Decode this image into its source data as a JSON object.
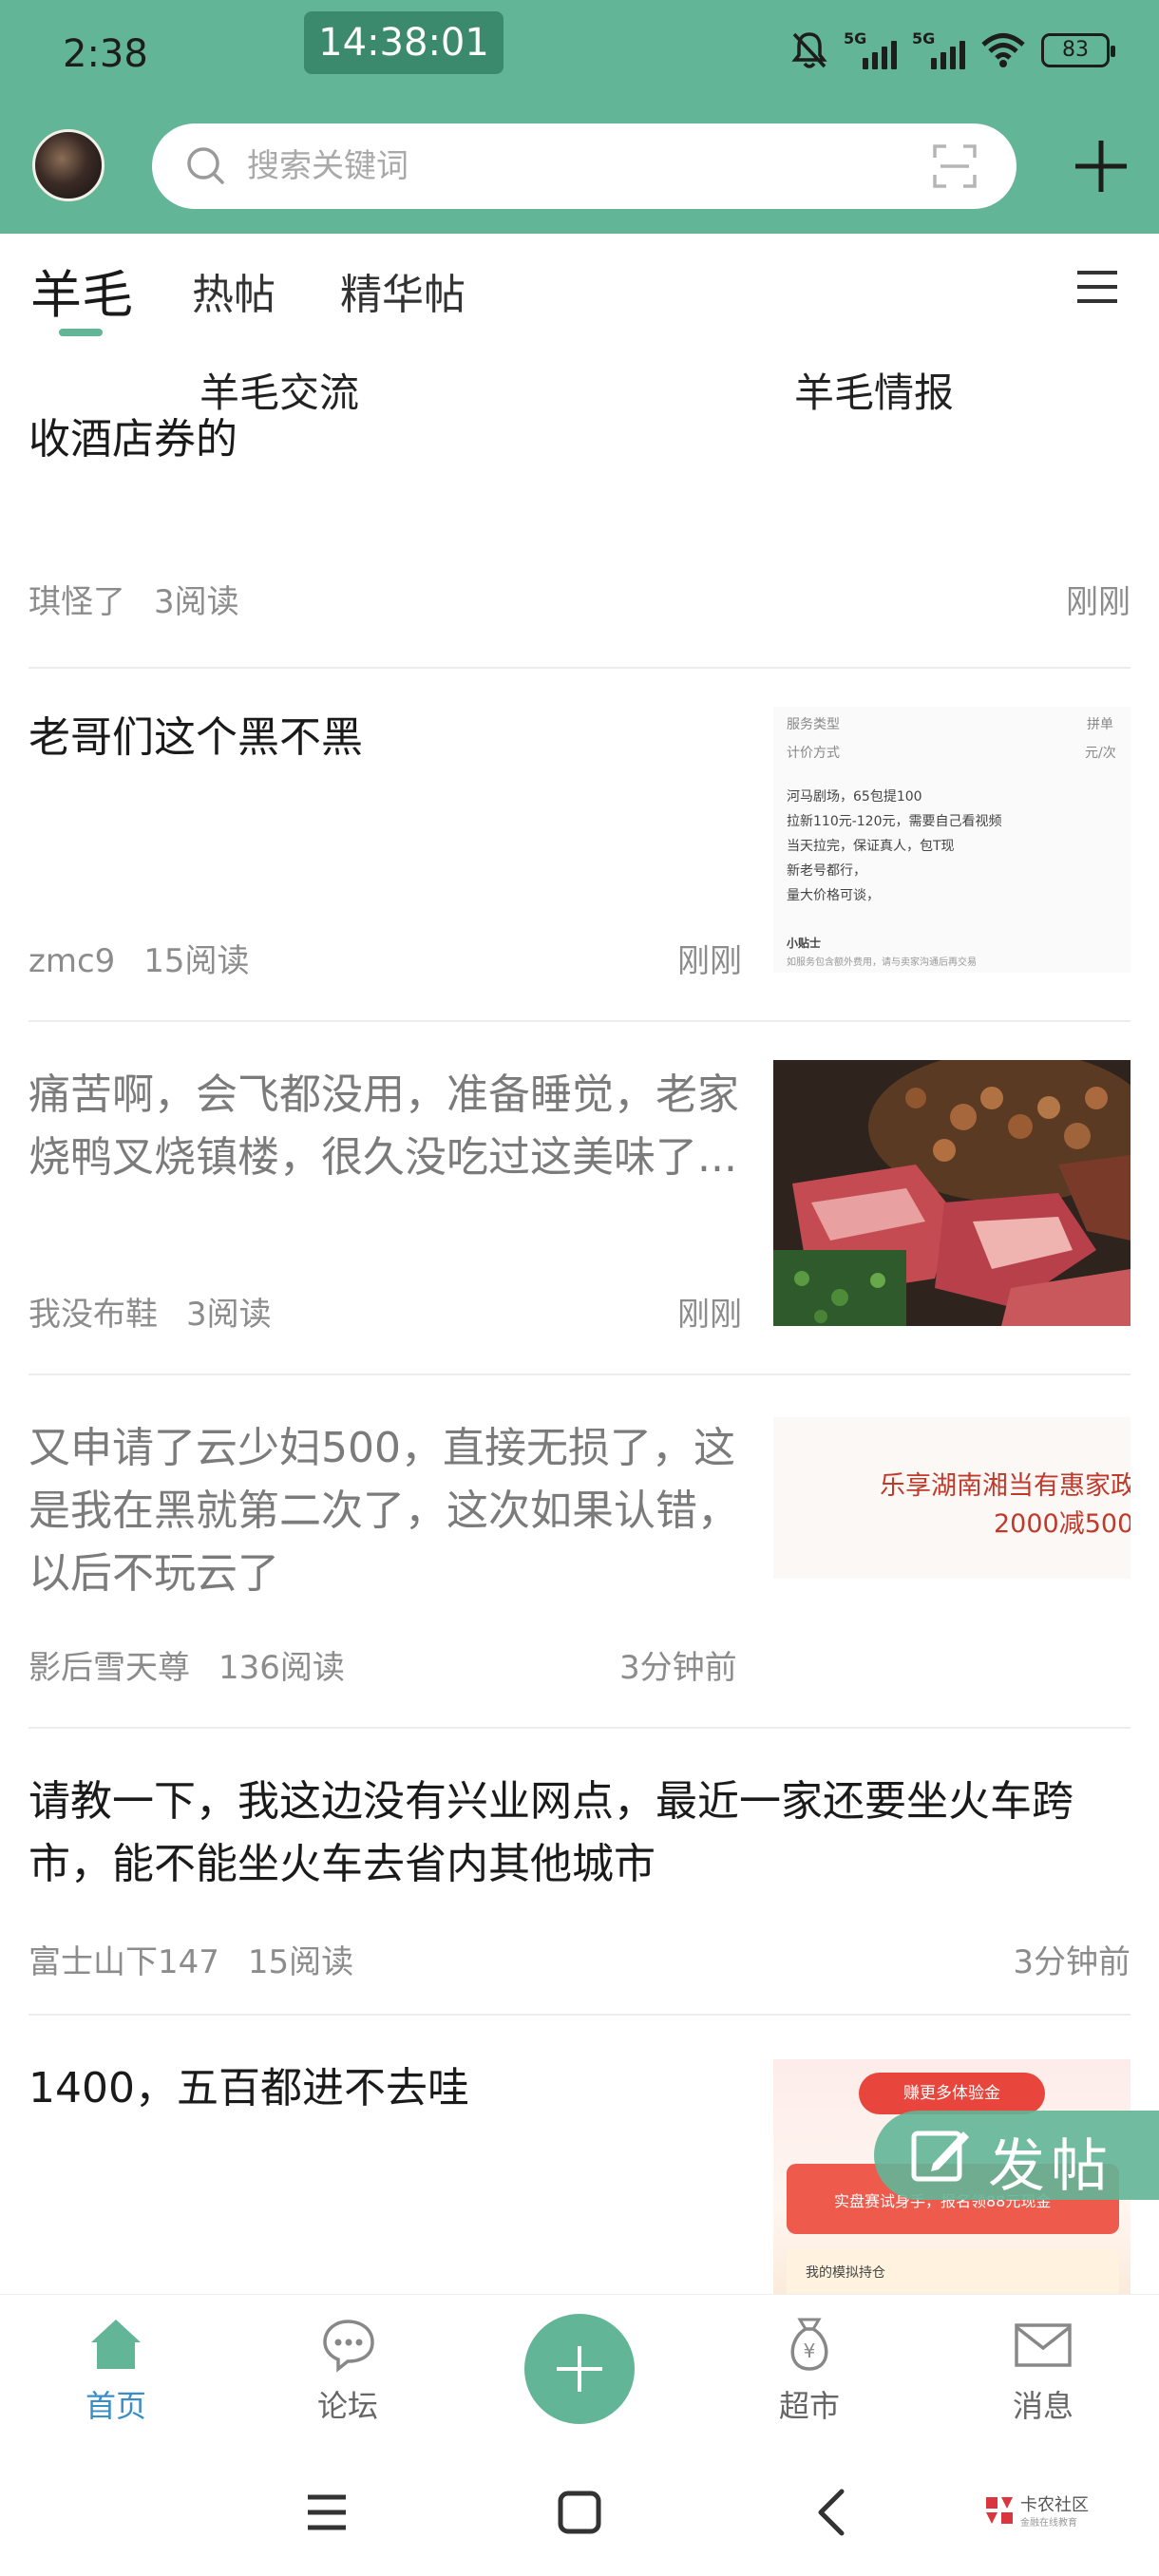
{
  "status_bar": {
    "time": "2:38",
    "clock": "14:38:01",
    "net1": "5G",
    "net2": "5G",
    "battery": "83"
  },
  "header": {
    "search_placeholder": "搜索关键词"
  },
  "tabs": [
    {
      "label": "羊毛"
    },
    {
      "label": "热帖"
    },
    {
      "label": "精华帖"
    }
  ],
  "subtabs": [
    {
      "label": "羊毛交流"
    },
    {
      "label": "羊毛情报"
    }
  ],
  "posts": [
    {
      "title": "收酒店券的",
      "author": "琪怪了",
      "reads": "3阅读",
      "time": "刚刚"
    },
    {
      "title": "老哥们这个黑不黑",
      "author": "zmc9",
      "reads": "15阅读",
      "time": "刚刚",
      "thumb_lines": [
        "服务类型",
        "拼单",
        "计价方式",
        "元/次",
        "河马剧场，65包提100",
        "拉新110元-120元，需要自己看视频",
        "当天拉完，保证真人，包T现",
        "新老号都行，",
        "量大价格可谈，",
        "小贴士",
        "如服务包含额外费用，请与卖家沟通后再交易"
      ]
    },
    {
      "title": "痛苦啊，会飞都没用，准备睡觉，老家烧鸭叉烧镇楼，很久没吃过这美味了...",
      "author": "我没布鞋",
      "reads": "3阅读",
      "time": "刚刚"
    },
    {
      "title": "又申请了云少妇500，直接无损了，这是我在黑就第二次了，这次如果认错，以后不玩云了",
      "author": "影后雪天尊",
      "reads": "136阅读",
      "time": "3分钟前",
      "thumb_lines": [
        "乐享湖南湘当有惠家政",
        "2000减500"
      ]
    },
    {
      "title": "请教一下，我这边没有兴业网点，最近一家还要坐火车跨市，能不能坐火车去省内其他城市",
      "author": "富士山下147",
      "reads": "15阅读",
      "time": "3分钟前"
    },
    {
      "title": "1400，五百都进不去哇",
      "author": "",
      "reads": "",
      "time": "",
      "thumb_lines": [
        "赚更多体验金",
        "实盘赛试身手，报名领88元现金",
        "我的模拟持仓"
      ]
    }
  ],
  "fab": {
    "label": "发帖"
  },
  "bottom_nav": [
    {
      "label": "首页"
    },
    {
      "label": "论坛"
    },
    {
      "label": "超市"
    },
    {
      "label": "消息"
    }
  ],
  "watermark": {
    "title": "卡农社区",
    "sub": "金融在线教育"
  },
  "colors": {
    "brand": "#62b597",
    "nav_active": "#3a8ec6",
    "meta": "#8c8c8c",
    "ad_red": "#c0392b"
  }
}
